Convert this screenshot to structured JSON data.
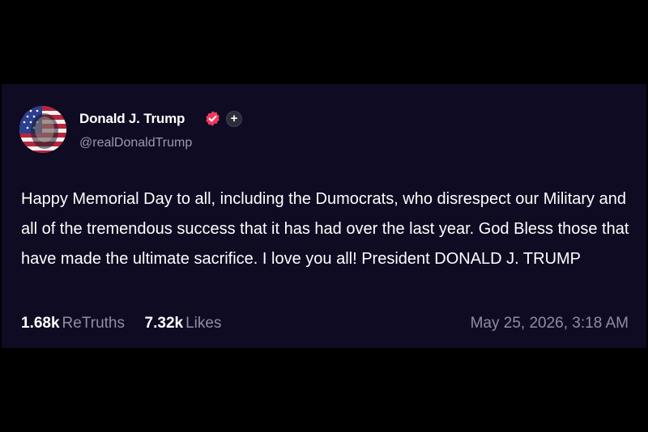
{
  "post": {
    "author": {
      "display_name": "Donald J. Trump",
      "handle": "@realDonaldTrump",
      "avatar_icon": "flag-portrait-avatar",
      "verified_icon": "verified-check-icon",
      "badge_icon": "plus-icon",
      "badge_symbol": "+"
    },
    "text": "Happy Memorial Day to all, including the Dumocrats, who disrespect our Military and all of the tremendous success that it has had over the last year. God Bless those that have made the ultimate sacrifice. I love you all! President DONALD J. TRUMP",
    "stats": {
      "retruths_count": "1.68k",
      "retruths_label": "ReTruths",
      "likes_count": "7.32k",
      "likes_label": "Likes"
    },
    "timestamp": "May 25, 2026, 3:18 AM"
  },
  "colors": {
    "page_background": "#000000",
    "card_background": "#0e0b22",
    "primary_text": "#ffffff",
    "secondary_text": "#8e8ea3",
    "verified_badge": "#f0385f"
  }
}
